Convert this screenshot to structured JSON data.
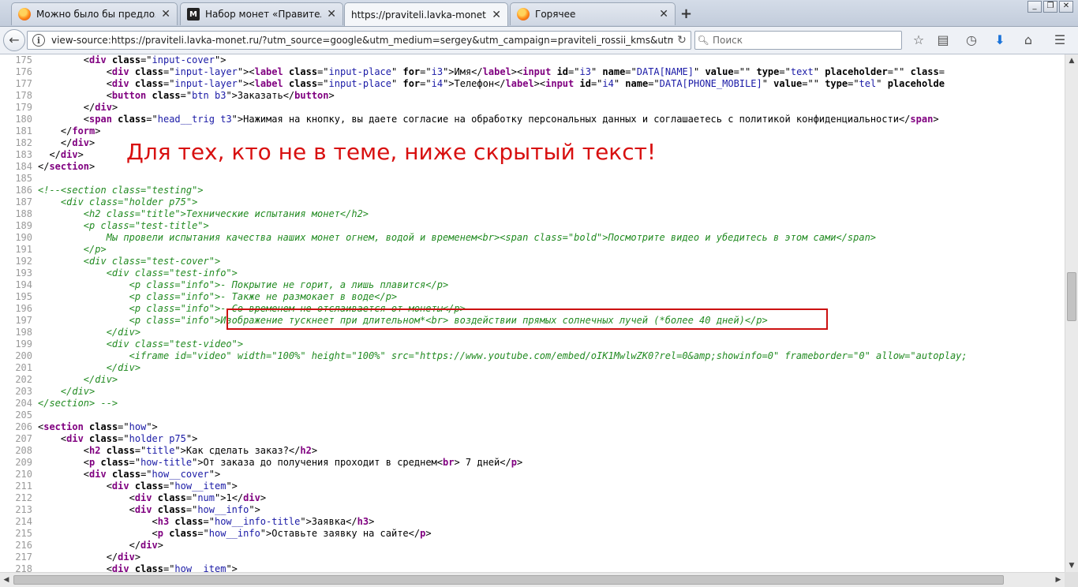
{
  "tabs": [
    {
      "title": "Можно было бы предложит...",
      "icon": "firefox-icon",
      "active": false
    },
    {
      "title": "Набор монет «Правители Ро...",
      "icon": "site-logo-icon",
      "active": false
    },
    {
      "title": "https://praviteli.lavka-monet.ru/?...",
      "icon": "",
      "active": true
    },
    {
      "title": "Горячее",
      "icon": "firefox-icon",
      "active": false
    }
  ],
  "site_logo_text": "M",
  "navbar": {
    "url": "view-source:https://praviteli.lavka-monet.ru/?utm_source=google&utm_medium=sergey&utm_campaign=praviteli_rossii_kms&utm_term=kms&utm_conten",
    "search_placeholder": "Поиск"
  },
  "overlay_text": "Для тех, кто не в теме, ниже скрытый текст!",
  "source_lines": [
    {
      "n": "175",
      "tokens": [
        [
          "p",
          "        "
        ],
        [
          "p",
          "<"
        ],
        [
          "t",
          "div"
        ],
        [
          "p",
          " "
        ],
        [
          "a",
          "class"
        ],
        [
          "p",
          "=\""
        ],
        [
          "v",
          "input-cover"
        ],
        [
          "p",
          "\">"
        ]
      ]
    },
    {
      "n": "176",
      "tokens": [
        [
          "p",
          "            <"
        ],
        [
          "t",
          "div"
        ],
        [
          "p",
          " "
        ],
        [
          "a",
          "class"
        ],
        [
          "p",
          "=\""
        ],
        [
          "v",
          "input-layer"
        ],
        [
          "p",
          "\"><"
        ],
        [
          "t",
          "label"
        ],
        [
          "p",
          " "
        ],
        [
          "a",
          "class"
        ],
        [
          "p",
          "=\""
        ],
        [
          "v",
          "input-place"
        ],
        [
          "p",
          "\" "
        ],
        [
          "a",
          "for"
        ],
        [
          "p",
          "=\""
        ],
        [
          "v",
          "i3"
        ],
        [
          "p",
          "\">Имя</"
        ],
        [
          "t",
          "label"
        ],
        [
          "p",
          "><"
        ],
        [
          "t",
          "input"
        ],
        [
          "p",
          " "
        ],
        [
          "a",
          "id"
        ],
        [
          "p",
          "=\""
        ],
        [
          "v",
          "i3"
        ],
        [
          "p",
          "\" "
        ],
        [
          "a",
          "name"
        ],
        [
          "p",
          "=\""
        ],
        [
          "v",
          "DATA[NAME]"
        ],
        [
          "p",
          "\" "
        ],
        [
          "a",
          "value"
        ],
        [
          "p",
          "=\"\" "
        ],
        [
          "a",
          "type"
        ],
        [
          "p",
          "=\""
        ],
        [
          "v",
          "text"
        ],
        [
          "p",
          "\" "
        ],
        [
          "a",
          "placeholder"
        ],
        [
          "p",
          "=\"\" "
        ],
        [
          "a",
          "class"
        ],
        [
          "p",
          "="
        ]
      ]
    },
    {
      "n": "177",
      "tokens": [
        [
          "p",
          "            <"
        ],
        [
          "t",
          "div"
        ],
        [
          "p",
          " "
        ],
        [
          "a",
          "class"
        ],
        [
          "p",
          "=\""
        ],
        [
          "v",
          "input-layer"
        ],
        [
          "p",
          "\"><"
        ],
        [
          "t",
          "label"
        ],
        [
          "p",
          " "
        ],
        [
          "a",
          "class"
        ],
        [
          "p",
          "=\""
        ],
        [
          "v",
          "input-place"
        ],
        [
          "p",
          "\" "
        ],
        [
          "a",
          "for"
        ],
        [
          "p",
          "=\""
        ],
        [
          "v",
          "i4"
        ],
        [
          "p",
          "\">Телефон</"
        ],
        [
          "t",
          "label"
        ],
        [
          "p",
          "><"
        ],
        [
          "t",
          "input"
        ],
        [
          "p",
          " "
        ],
        [
          "a",
          "id"
        ],
        [
          "p",
          "=\""
        ],
        [
          "v",
          "i4"
        ],
        [
          "p",
          "\" "
        ],
        [
          "a",
          "name"
        ],
        [
          "p",
          "=\""
        ],
        [
          "v",
          "DATA[PHONE_MOBILE]"
        ],
        [
          "p",
          "\" "
        ],
        [
          "a",
          "value"
        ],
        [
          "p",
          "=\"\" "
        ],
        [
          "a",
          "type"
        ],
        [
          "p",
          "=\""
        ],
        [
          "v",
          "tel"
        ],
        [
          "p",
          "\" "
        ],
        [
          "a",
          "placeholde"
        ]
      ]
    },
    {
      "n": "178",
      "tokens": [
        [
          "p",
          "            <"
        ],
        [
          "t",
          "button"
        ],
        [
          "p",
          " "
        ],
        [
          "a",
          "class"
        ],
        [
          "p",
          "=\""
        ],
        [
          "v",
          "btn b3"
        ],
        [
          "p",
          "\">Заказать</"
        ],
        [
          "t",
          "button"
        ],
        [
          "p",
          ">"
        ]
      ]
    },
    {
      "n": "179",
      "tokens": [
        [
          "p",
          "        </"
        ],
        [
          "t",
          "div"
        ],
        [
          "p",
          ">"
        ]
      ]
    },
    {
      "n": "180",
      "tokens": [
        [
          "p",
          "        <"
        ],
        [
          "t",
          "span"
        ],
        [
          "p",
          " "
        ],
        [
          "a",
          "class"
        ],
        [
          "p",
          "=\""
        ],
        [
          "v",
          "head__trig t3"
        ],
        [
          "p",
          "\">Нажимая на кнопку, вы даете согласие на обработку персональных данных и соглашаетесь с политикой конфиденциальности</"
        ],
        [
          "t",
          "span"
        ],
        [
          "p",
          ">"
        ]
      ]
    },
    {
      "n": "181",
      "tokens": [
        [
          "p",
          "    </"
        ],
        [
          "t",
          "form"
        ],
        [
          "p",
          ">"
        ]
      ]
    },
    {
      "n": "182",
      "tokens": [
        [
          "p",
          "    </"
        ],
        [
          "t",
          "div"
        ],
        [
          "p",
          ">"
        ]
      ]
    },
    {
      "n": "183",
      "tokens": [
        [
          "p",
          "  </"
        ],
        [
          "t",
          "div"
        ],
        [
          "p",
          ">"
        ]
      ]
    },
    {
      "n": "184",
      "tokens": [
        [
          "p",
          "</"
        ],
        [
          "t",
          "section"
        ],
        [
          "p",
          ">"
        ]
      ]
    },
    {
      "n": "185",
      "tokens": []
    },
    {
      "n": "186",
      "tokens": [
        [
          "c",
          "<!--<section class=\"testing\">"
        ]
      ]
    },
    {
      "n": "187",
      "tokens": [
        [
          "c",
          "    <div class=\"holder p75\">"
        ]
      ]
    },
    {
      "n": "188",
      "tokens": [
        [
          "c",
          "        <h2 class=\"title\">Технические испытания монет</h2>"
        ]
      ]
    },
    {
      "n": "189",
      "tokens": [
        [
          "c",
          "        <p class=\"test-title\">"
        ]
      ]
    },
    {
      "n": "190",
      "tokens": [
        [
          "c",
          "            Мы провели испытания качества наших монет огнем, водой и временем<br><span class=\"bold\">Посмотрите видео и убедитесь в этом сами</span>"
        ]
      ]
    },
    {
      "n": "191",
      "tokens": [
        [
          "c",
          "        </p>"
        ]
      ]
    },
    {
      "n": "192",
      "tokens": [
        [
          "c",
          "        <div class=\"test-cover\">"
        ]
      ]
    },
    {
      "n": "193",
      "tokens": [
        [
          "c",
          "            <div class=\"test-info\">"
        ]
      ]
    },
    {
      "n": "194",
      "tokens": [
        [
          "c",
          "                <p class=\"info\">- Покрытие не горит, а лишь плавится</p>"
        ]
      ]
    },
    {
      "n": "195",
      "tokens": [
        [
          "c",
          "                <p class=\"info\">- Также не размокает в воде</p>"
        ]
      ]
    },
    {
      "n": "196",
      "tokens": [
        [
          "c",
          "                <p class=\"info\">- Со временем не отслаивается от монеты</p>"
        ]
      ]
    },
    {
      "n": "197",
      "tokens": [
        [
          "c",
          "                <p class=\"info\">Изображение тускнеет при длительном*<br> воздействии прямых солнечных лучей (*более 40 дней)</p>"
        ]
      ]
    },
    {
      "n": "198",
      "tokens": [
        [
          "c",
          "            </div>"
        ]
      ]
    },
    {
      "n": "199",
      "tokens": [
        [
          "c",
          "            <div class=\"test-video\">"
        ]
      ]
    },
    {
      "n": "200",
      "tokens": [
        [
          "c",
          "                <iframe id=\"video\" width=\"100%\" height=\"100%\" src=\"https://www.youtube.com/embed/oIK1MwlwZK0?rel=0&amp;showinfo=0\" frameborder=\"0\" allow=\"autoplay;"
        ]
      ]
    },
    {
      "n": "201",
      "tokens": [
        [
          "c",
          "            </div>"
        ]
      ]
    },
    {
      "n": "202",
      "tokens": [
        [
          "c",
          "        </div>"
        ]
      ]
    },
    {
      "n": "203",
      "tokens": [
        [
          "c",
          "    </div>"
        ]
      ]
    },
    {
      "n": "204",
      "tokens": [
        [
          "c",
          "</section> -->"
        ]
      ]
    },
    {
      "n": "205",
      "tokens": []
    },
    {
      "n": "206",
      "tokens": [
        [
          "p",
          "<"
        ],
        [
          "t",
          "section"
        ],
        [
          "p",
          " "
        ],
        [
          "a",
          "class"
        ],
        [
          "p",
          "=\""
        ],
        [
          "v",
          "how"
        ],
        [
          "p",
          "\">"
        ]
      ]
    },
    {
      "n": "207",
      "tokens": [
        [
          "p",
          "    <"
        ],
        [
          "t",
          "div"
        ],
        [
          "p",
          " "
        ],
        [
          "a",
          "class"
        ],
        [
          "p",
          "=\""
        ],
        [
          "v",
          "holder p75"
        ],
        [
          "p",
          "\">"
        ]
      ]
    },
    {
      "n": "208",
      "tokens": [
        [
          "p",
          "        <"
        ],
        [
          "t",
          "h2"
        ],
        [
          "p",
          " "
        ],
        [
          "a",
          "class"
        ],
        [
          "p",
          "=\""
        ],
        [
          "v",
          "title"
        ],
        [
          "p",
          "\">Как сделать заказ?</"
        ],
        [
          "t",
          "h2"
        ],
        [
          "p",
          ">"
        ]
      ]
    },
    {
      "n": "209",
      "tokens": [
        [
          "p",
          "        <"
        ],
        [
          "t",
          "p"
        ],
        [
          "p",
          " "
        ],
        [
          "a",
          "class"
        ],
        [
          "p",
          "=\""
        ],
        [
          "v",
          "how-title"
        ],
        [
          "p",
          "\">От заказа до получения проходит в среднем<"
        ],
        [
          "t",
          "br"
        ],
        [
          "p",
          "> 7 дней</"
        ],
        [
          "t",
          "p"
        ],
        [
          "p",
          ">"
        ]
      ]
    },
    {
      "n": "210",
      "tokens": [
        [
          "p",
          "        <"
        ],
        [
          "t",
          "div"
        ],
        [
          "p",
          " "
        ],
        [
          "a",
          "class"
        ],
        [
          "p",
          "=\""
        ],
        [
          "v",
          "how__cover"
        ],
        [
          "p",
          "\">"
        ]
      ]
    },
    {
      "n": "211",
      "tokens": [
        [
          "p",
          "            <"
        ],
        [
          "t",
          "div"
        ],
        [
          "p",
          " "
        ],
        [
          "a",
          "class"
        ],
        [
          "p",
          "=\""
        ],
        [
          "v",
          "how__item"
        ],
        [
          "p",
          "\">"
        ]
      ]
    },
    {
      "n": "212",
      "tokens": [
        [
          "p",
          "                <"
        ],
        [
          "t",
          "div"
        ],
        [
          "p",
          " "
        ],
        [
          "a",
          "class"
        ],
        [
          "p",
          "=\""
        ],
        [
          "v",
          "num"
        ],
        [
          "p",
          "\">1</"
        ],
        [
          "t",
          "div"
        ],
        [
          "p",
          ">"
        ]
      ]
    },
    {
      "n": "213",
      "tokens": [
        [
          "p",
          "                <"
        ],
        [
          "t",
          "div"
        ],
        [
          "p",
          " "
        ],
        [
          "a",
          "class"
        ],
        [
          "p",
          "=\""
        ],
        [
          "v",
          "how__info"
        ],
        [
          "p",
          "\">"
        ]
      ]
    },
    {
      "n": "214",
      "tokens": [
        [
          "p",
          "                    <"
        ],
        [
          "t",
          "h3"
        ],
        [
          "p",
          " "
        ],
        [
          "a",
          "class"
        ],
        [
          "p",
          "=\""
        ],
        [
          "v",
          "how__info-title"
        ],
        [
          "p",
          "\">Заявка</"
        ],
        [
          "t",
          "h3"
        ],
        [
          "p",
          ">"
        ]
      ]
    },
    {
      "n": "215",
      "tokens": [
        [
          "p",
          "                    <"
        ],
        [
          "t",
          "p"
        ],
        [
          "p",
          " "
        ],
        [
          "a",
          "class"
        ],
        [
          "p",
          "=\""
        ],
        [
          "v",
          "how__info"
        ],
        [
          "p",
          "\">Оставьте заявку на сайте</"
        ],
        [
          "t",
          "p"
        ],
        [
          "p",
          ">"
        ]
      ]
    },
    {
      "n": "216",
      "tokens": [
        [
          "p",
          "                </"
        ],
        [
          "t",
          "div"
        ],
        [
          "p",
          ">"
        ]
      ]
    },
    {
      "n": "217",
      "tokens": [
        [
          "p",
          "            </"
        ],
        [
          "t",
          "div"
        ],
        [
          "p",
          ">"
        ]
      ]
    },
    {
      "n": "218",
      "tokens": [
        [
          "p",
          "            <"
        ],
        [
          "t",
          "div"
        ],
        [
          "p",
          " "
        ],
        [
          "a",
          "class"
        ],
        [
          "p",
          "=\""
        ],
        [
          "v",
          "how__item"
        ],
        [
          "p",
          "\">"
        ]
      ]
    }
  ]
}
